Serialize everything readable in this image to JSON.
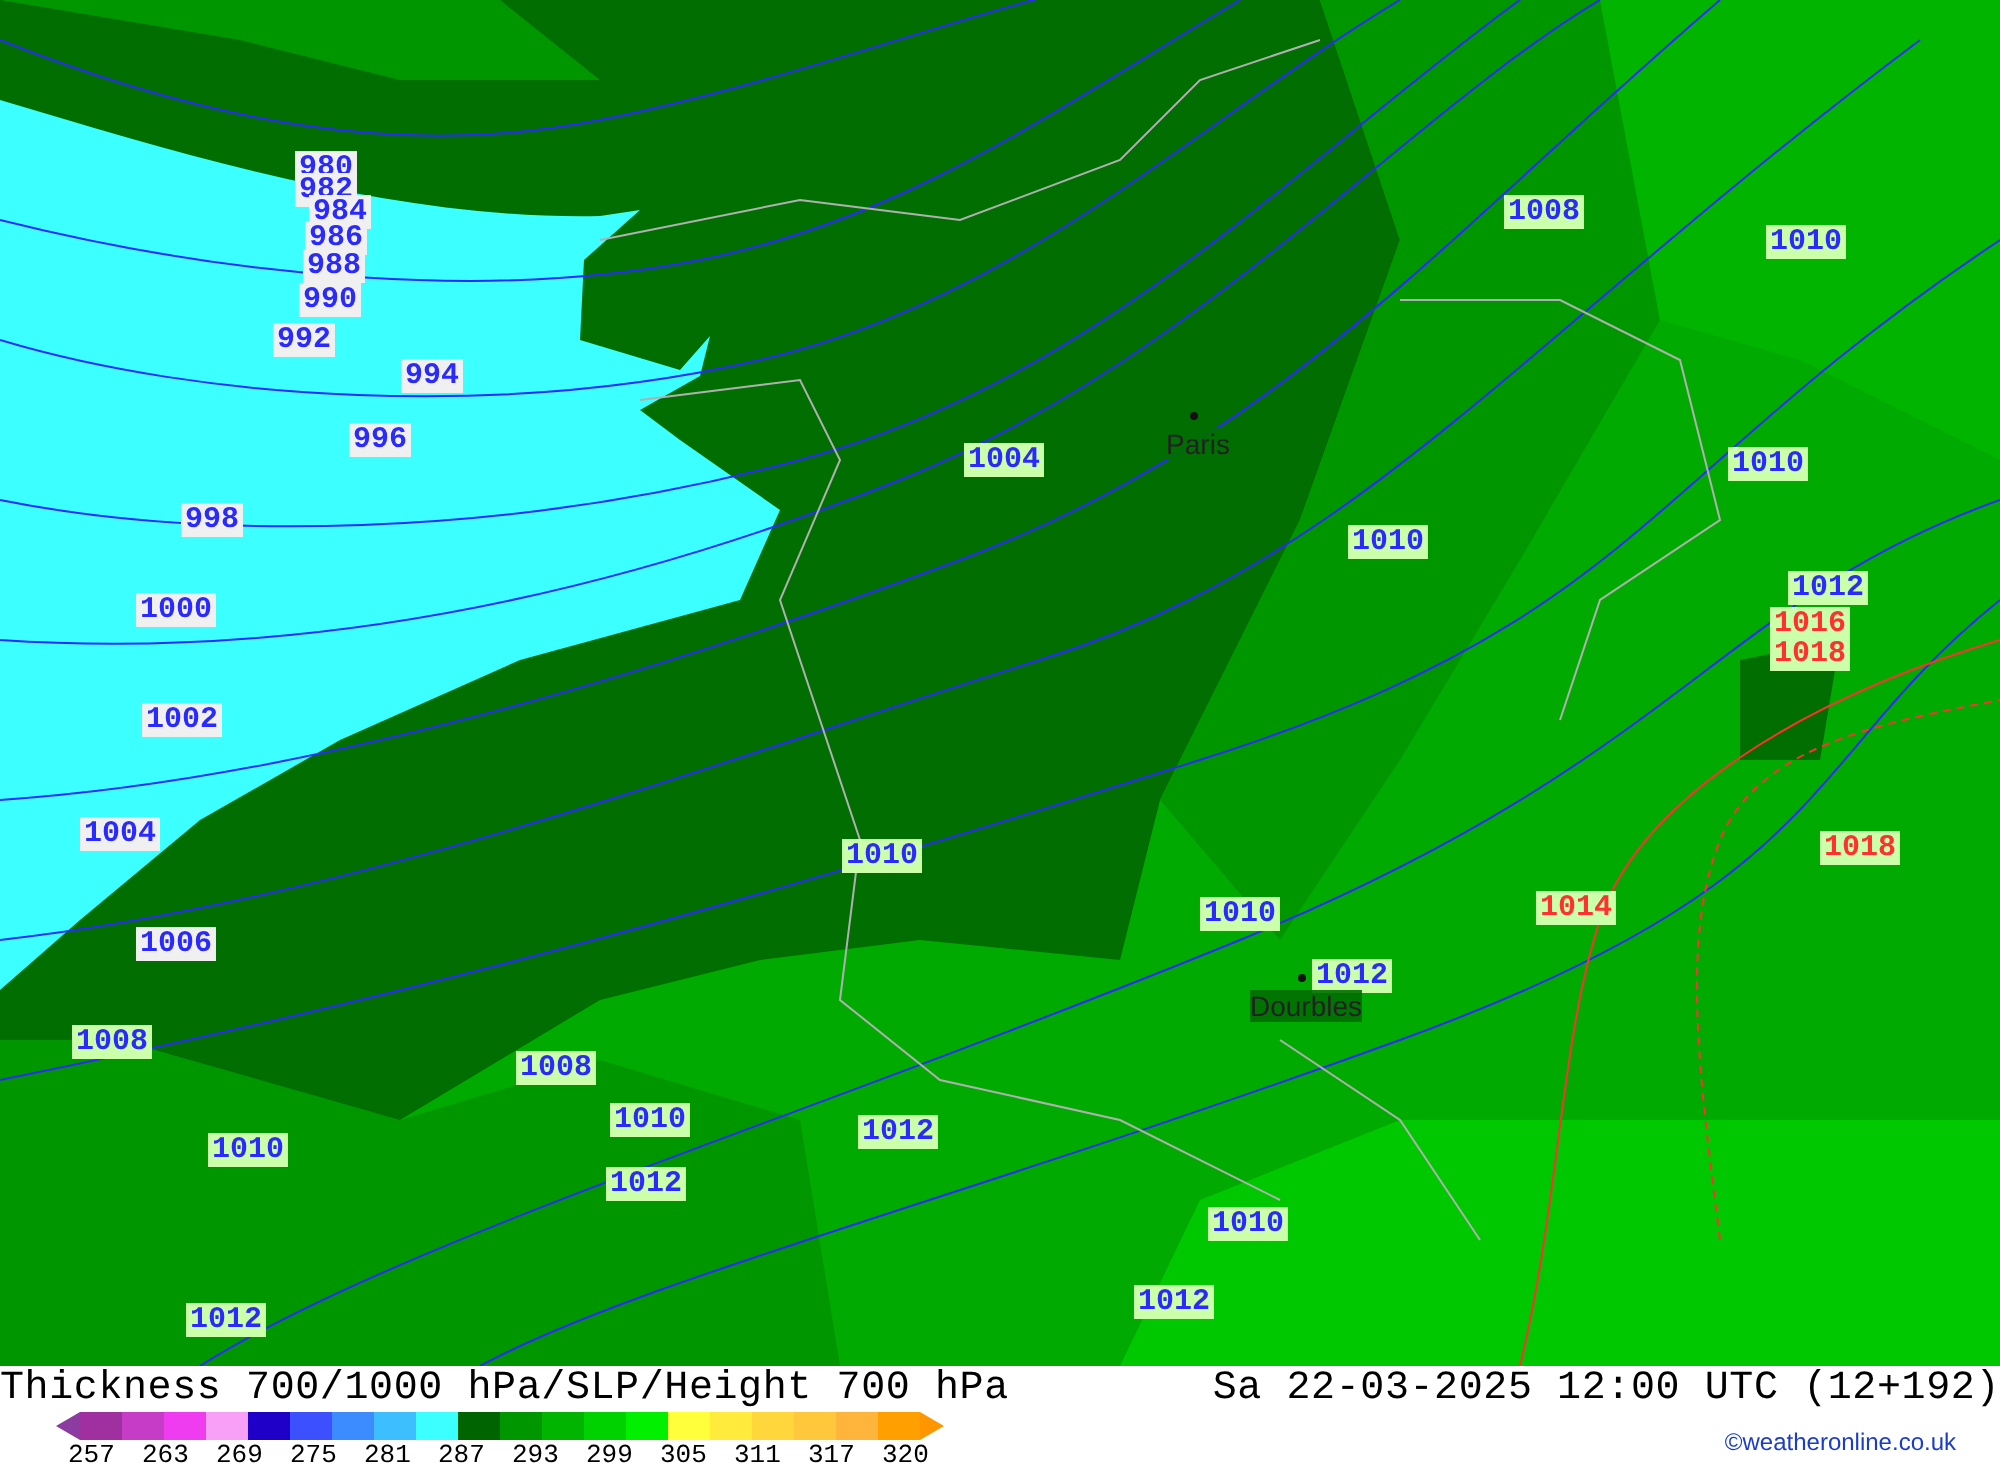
{
  "map": {
    "isobar_labels": [
      {
        "text": "980",
        "kind": "low"
      },
      {
        "text": "982",
        "kind": "low"
      },
      {
        "text": "984",
        "kind": "low"
      },
      {
        "text": "986",
        "kind": "low"
      },
      {
        "text": "988",
        "kind": "low"
      },
      {
        "text": "990",
        "kind": "low"
      },
      {
        "text": "992",
        "kind": "low"
      },
      {
        "text": "994",
        "kind": "low"
      },
      {
        "text": "996",
        "kind": "low"
      },
      {
        "text": "998",
        "kind": "low"
      },
      {
        "text": "1000",
        "kind": "low"
      },
      {
        "text": "1002",
        "kind": "low"
      },
      {
        "text": "1004",
        "kind": "low"
      },
      {
        "text": "1006",
        "kind": "low"
      },
      {
        "text": "1008",
        "kind": "low"
      },
      {
        "text": "1010",
        "kind": "low"
      },
      {
        "text": "1012",
        "kind": "low"
      },
      {
        "text": "1008",
        "kind": "low"
      },
      {
        "text": "1010",
        "kind": "low"
      },
      {
        "text": "1012",
        "kind": "low"
      },
      {
        "text": "1012",
        "kind": "low"
      },
      {
        "text": "1010",
        "kind": "low"
      },
      {
        "text": "1004",
        "kind": "low"
      },
      {
        "text": "1008",
        "kind": "low"
      },
      {
        "text": "1010",
        "kind": "low"
      },
      {
        "text": "1010",
        "kind": "low"
      },
      {
        "text": "1010",
        "kind": "low"
      },
      {
        "text": "1012",
        "kind": "low"
      },
      {
        "text": "1016",
        "kind": "high"
      },
      {
        "text": "1018",
        "kind": "high"
      },
      {
        "text": "1018",
        "kind": "high"
      },
      {
        "text": "1014",
        "kind": "high"
      },
      {
        "text": "1010",
        "kind": "low"
      },
      {
        "text": "1012",
        "kind": "low"
      },
      {
        "text": "1010",
        "kind": "low"
      },
      {
        "text": "1012",
        "kind": "low"
      }
    ],
    "cities": [
      "Paris",
      "Dourbles"
    ]
  },
  "footer": {
    "title": "Thickness 700/1000 hPa/SLP/Height 700 hPa",
    "valid_time": "Sa 22-03-2025 12:00 UTC (12+192)",
    "legend": {
      "swatches": [
        {
          "color": "#8c3ca0"
        },
        {
          "color": "#a030a0"
        },
        {
          "color": "#c63cc6"
        },
        {
          "color": "#f03cf0"
        },
        {
          "color": "#f8a0f8"
        },
        {
          "color": "#1e00c8"
        },
        {
          "color": "#3c50ff"
        },
        {
          "color": "#3c8cff"
        },
        {
          "color": "#3cbeff"
        },
        {
          "color": "#3cffff"
        },
        {
          "color": "#006400"
        },
        {
          "color": "#009600"
        },
        {
          "color": "#00b400"
        },
        {
          "color": "#00d200"
        },
        {
          "color": "#00f000"
        },
        {
          "color": "#ffff3c"
        },
        {
          "color": "#ffeb3c"
        },
        {
          "color": "#ffd73c"
        },
        {
          "color": "#ffc83c"
        },
        {
          "color": "#ffb43c"
        },
        {
          "color": "#ffa000"
        },
        {
          "color": "#ff9600"
        }
      ],
      "ticks": [
        "257",
        "263",
        "269",
        "275",
        "281",
        "287",
        "293",
        "299",
        "305",
        "311",
        "317",
        "320"
      ]
    },
    "credit": "©weatheronline.co.uk"
  }
}
